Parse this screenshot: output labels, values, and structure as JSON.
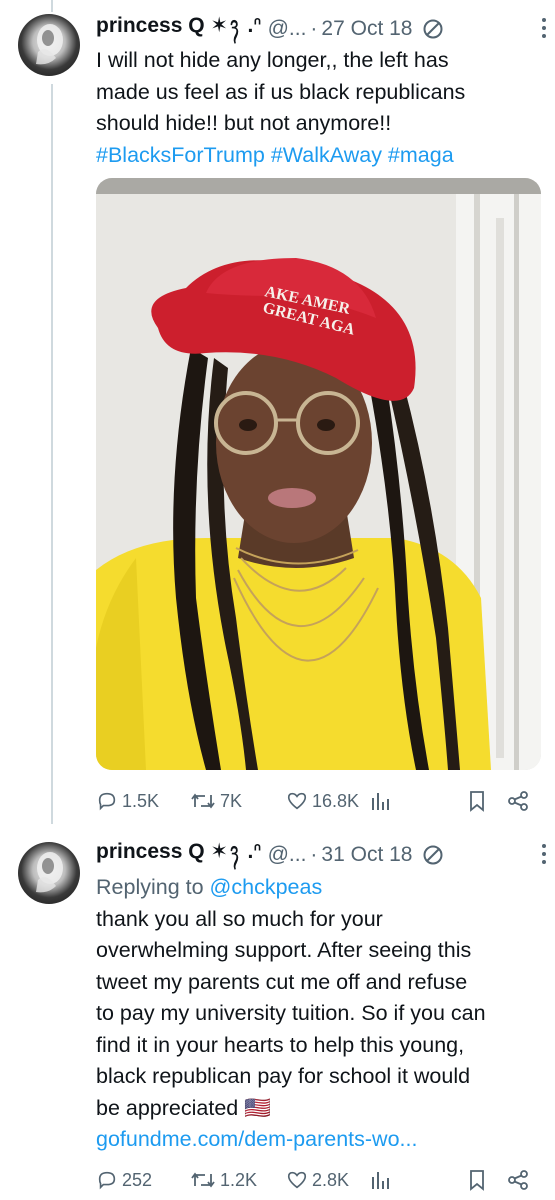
{
  "tweets": [
    {
      "author_name": "princess Q ✶᭪ .ᐢ",
      "handle": "@...",
      "date": "27 Oct 18",
      "text_lines": [
        "I will not hide any longer,, the left has",
        "made us feel as if us black republicans",
        "should hide!! but not anymore!!"
      ],
      "hashtags": "#BlacksForTrump #WalkAway #maga",
      "media": {
        "hat_text_line1": "AKE AMER",
        "hat_text_line2": "GREAT AGA"
      },
      "stats": {
        "replies": "1.5K",
        "reposts": "7K",
        "likes": "16.8K"
      }
    },
    {
      "author_name": "princess Q ✶᭪ .ᐢ",
      "handle": "@...",
      "date": "31 Oct 18",
      "replying_label": "Replying to ",
      "replying_to": "@chckpeas",
      "text_lines": [
        "thank you all so much for your",
        "overwhelming support. After seeing this",
        "tweet my parents cut me off and refuse",
        "to pay my university tuition. So if you can",
        "find it in your hearts to help this young,",
        "black republican pay for school it would",
        "be appreciated 🇺🇸"
      ],
      "link": "gofundme.com/dem-parents-wo...",
      "stats": {
        "replies": "252",
        "reposts": "1.2K",
        "likes": "2.8K"
      }
    }
  ],
  "icons": {
    "reply": "reply-icon",
    "repost": "repost-icon",
    "like": "heart-icon",
    "views": "views-icon",
    "bookmark": "bookmark-icon",
    "share": "share-icon",
    "more": "more-icon",
    "blocked": "ban-icon"
  },
  "colors": {
    "link": "#1d9bf0",
    "secondary_text": "#536471",
    "thread_line": "#cfd9de",
    "hat_red": "#d1202f",
    "shirt_yellow": "#ffe43a"
  }
}
